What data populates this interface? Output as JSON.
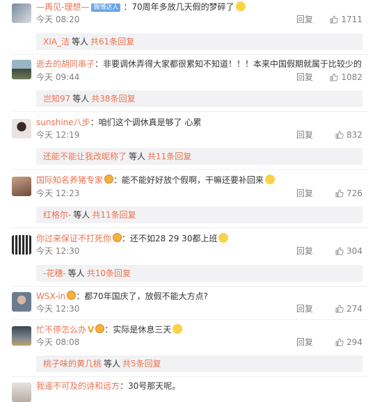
{
  "comments": [
    {
      "username": "—再见-理想—",
      "badge": "微博达人",
      "text": "：70周年多放几天假的梦碎了",
      "time": "今天 08:20",
      "reply": "回复",
      "likes": "1711",
      "sub": {
        "user": "XIA_洁",
        "mid": "等人",
        "count": "共61条回复"
      }
    },
    {
      "username": "逝去的胡同串子",
      "text": "：非要调休弄得大家都很累知不知道！！！本来中国假期就属于比较少的",
      "time": "今天 09:44",
      "reply": "回复",
      "likes": "1082",
      "sub": {
        "user": "岂知97",
        "mid": "等人",
        "count": "共38条回复"
      }
    },
    {
      "username": "sunshine八步",
      "text": "：咱们这个调休真是够了 心累",
      "time": "今天 12:19",
      "reply": "回复",
      "likes": "832",
      "sub": {
        "user": "还能不能让我改昵称了",
        "mid": "等人",
        "count": "共11条回复"
      }
    },
    {
      "username": "国际知名养猪专家",
      "text": "：能不能好好放个假啊，干嘛还要补回来",
      "time": "今天 12:23",
      "reply": "回复",
      "likes": "726",
      "sub": {
        "user": "红格尔-",
        "mid": "等人",
        "count": "共11条回复"
      }
    },
    {
      "username": "你过来保证不打死你",
      "text": "：还不如28 29 30都上班",
      "time": "今天 12:30",
      "reply": "回复",
      "likes": "304",
      "sub": {
        "user": "-花穗-",
        "mid": "等人",
        "count": "共10条回复"
      }
    },
    {
      "username": "WSX-in",
      "text": "：都70年国庆了，放假不能大方点?",
      "time": "今天 12:30",
      "reply": "回复",
      "likes": "274"
    },
    {
      "username": "忙不停怎么办",
      "vip": "V",
      "text": "：实际是休息三天",
      "time": "今天 08:08",
      "reply": "回复",
      "likes": "294",
      "sub": {
        "user": "桃子味的黄几桃",
        "mid": "等人",
        "count": "共5条回复"
      }
    },
    {
      "username": "我遥不可及的诗和远方",
      "text": "：30号那天呢。"
    }
  ],
  "icons": {
    "thumb": "thumbs-up-icon",
    "crown": "member-crown-icon",
    "emoji": "emoji-icon"
  },
  "colors": {
    "username": "#eb7350",
    "meta": "#808080",
    "sub_bg": "#f2f2f5"
  }
}
